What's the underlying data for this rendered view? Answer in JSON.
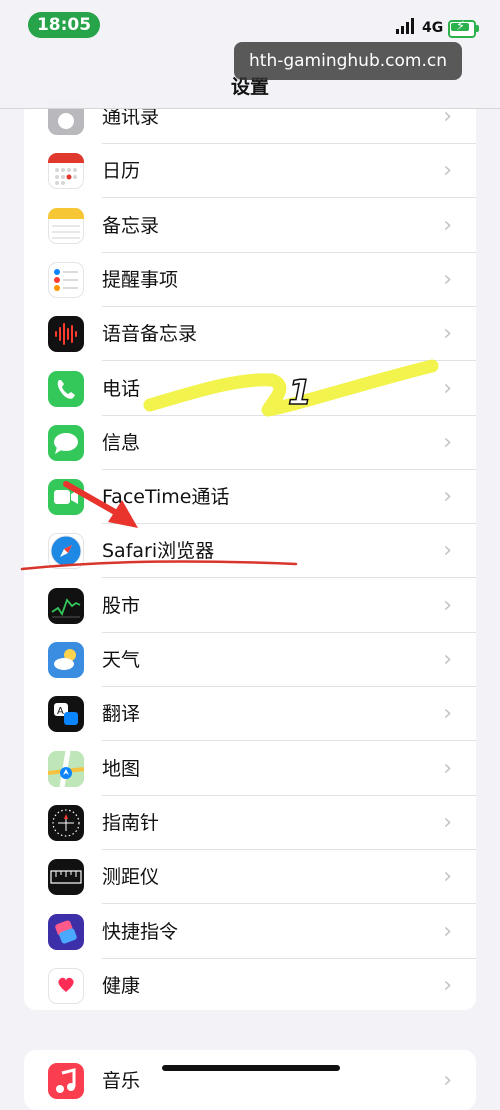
{
  "status_bar": {
    "time": "18:05",
    "network": "4G"
  },
  "nav": {
    "title": "设置"
  },
  "watermark": "hth-gaminghub.com.cn",
  "rows": [
    {
      "label": "通讯录",
      "icon": "contacts-icon",
      "color": "#b9b9bd"
    },
    {
      "label": "日历",
      "icon": "calendar-icon",
      "color": "#ffffff"
    },
    {
      "label": "备忘录",
      "icon": "notes-icon",
      "color": "#ffffff"
    },
    {
      "label": "提醒事项",
      "icon": "reminders-icon",
      "color": "#ffffff"
    },
    {
      "label": "语音备忘录",
      "icon": "voice-memos-icon",
      "color": "#111111"
    },
    {
      "label": "电话",
      "icon": "phone-icon",
      "color": "#34c759"
    },
    {
      "label": "信息",
      "icon": "messages-icon",
      "color": "#34c759"
    },
    {
      "label": "FaceTime通话",
      "icon": "facetime-icon",
      "color": "#34c759"
    },
    {
      "label": "Safari浏览器",
      "icon": "safari-icon",
      "color": "#ffffff"
    },
    {
      "label": "股市",
      "icon": "stocks-icon",
      "color": "#111111"
    },
    {
      "label": "天气",
      "icon": "weather-icon",
      "color": "#3a8de0"
    },
    {
      "label": "翻译",
      "icon": "translate-icon",
      "color": "#111111"
    },
    {
      "label": "地图",
      "icon": "maps-icon",
      "color": "#8fd18f"
    },
    {
      "label": "指南针",
      "icon": "compass-icon",
      "color": "#111111"
    },
    {
      "label": "测距仪",
      "icon": "measure-icon",
      "color": "#111111"
    },
    {
      "label": "快捷指令",
      "icon": "shortcuts-icon",
      "color": "#3c2fa8"
    },
    {
      "label": "健康",
      "icon": "health-icon",
      "color": "#ffffff"
    }
  ],
  "next_group": [
    {
      "label": "音乐",
      "icon": "music-icon",
      "color": "#fa3d4f"
    }
  ],
  "annotation": {
    "number_label": "1",
    "highlight_color": "#f2f23a",
    "arrow_color": "#e8342c"
  }
}
